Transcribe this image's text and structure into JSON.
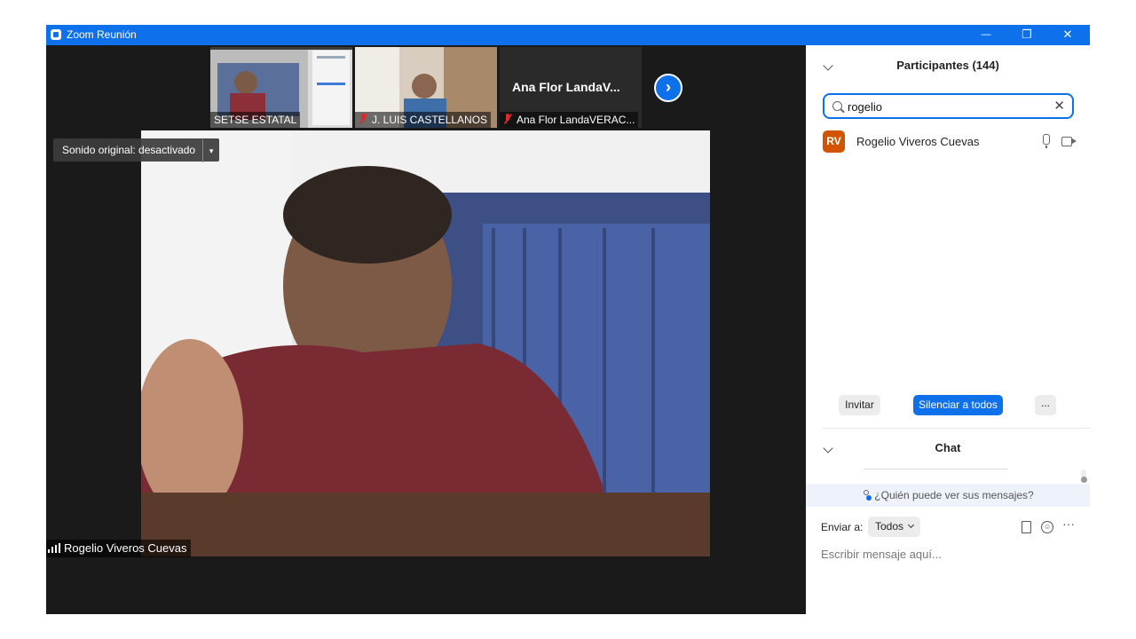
{
  "window": {
    "title": "Zoom Reunión",
    "controls": {
      "minimize": "—",
      "restore": "❐",
      "close": "✕"
    }
  },
  "thumbnails": [
    {
      "name": "SETSE ESTATAL",
      "muted": false
    },
    {
      "name": "J. LUIS CASTELLANOS",
      "muted": true
    },
    {
      "name": "Ana Flor LandaVERAC...",
      "label": "Ana Flor LandaV...",
      "muted": true
    }
  ],
  "video": {
    "sound_label": "Sonido original: desactivado",
    "active_speaker": "Rogelio Viveros Cuevas"
  },
  "participants": {
    "title": "Participantes (144)",
    "search_value": "rogelio",
    "list": [
      {
        "initials": "RV",
        "name": "Rogelio Viveros Cuevas",
        "avatar_color": "#d35400"
      }
    ],
    "buttons": {
      "invite": "Invitar",
      "mute_all": "Silenciar a todos",
      "more": "..."
    }
  },
  "chat": {
    "title": "Chat",
    "who_can_see": "¿Quién puede ver sus mensajes?",
    "send_to_label": "Enviar a:",
    "recipient": "Todos",
    "more": "···",
    "placeholder": "Escribir mensaje aquí..."
  },
  "colors": {
    "accent": "#0e71eb",
    "video_bg": "#1a1a1a"
  }
}
